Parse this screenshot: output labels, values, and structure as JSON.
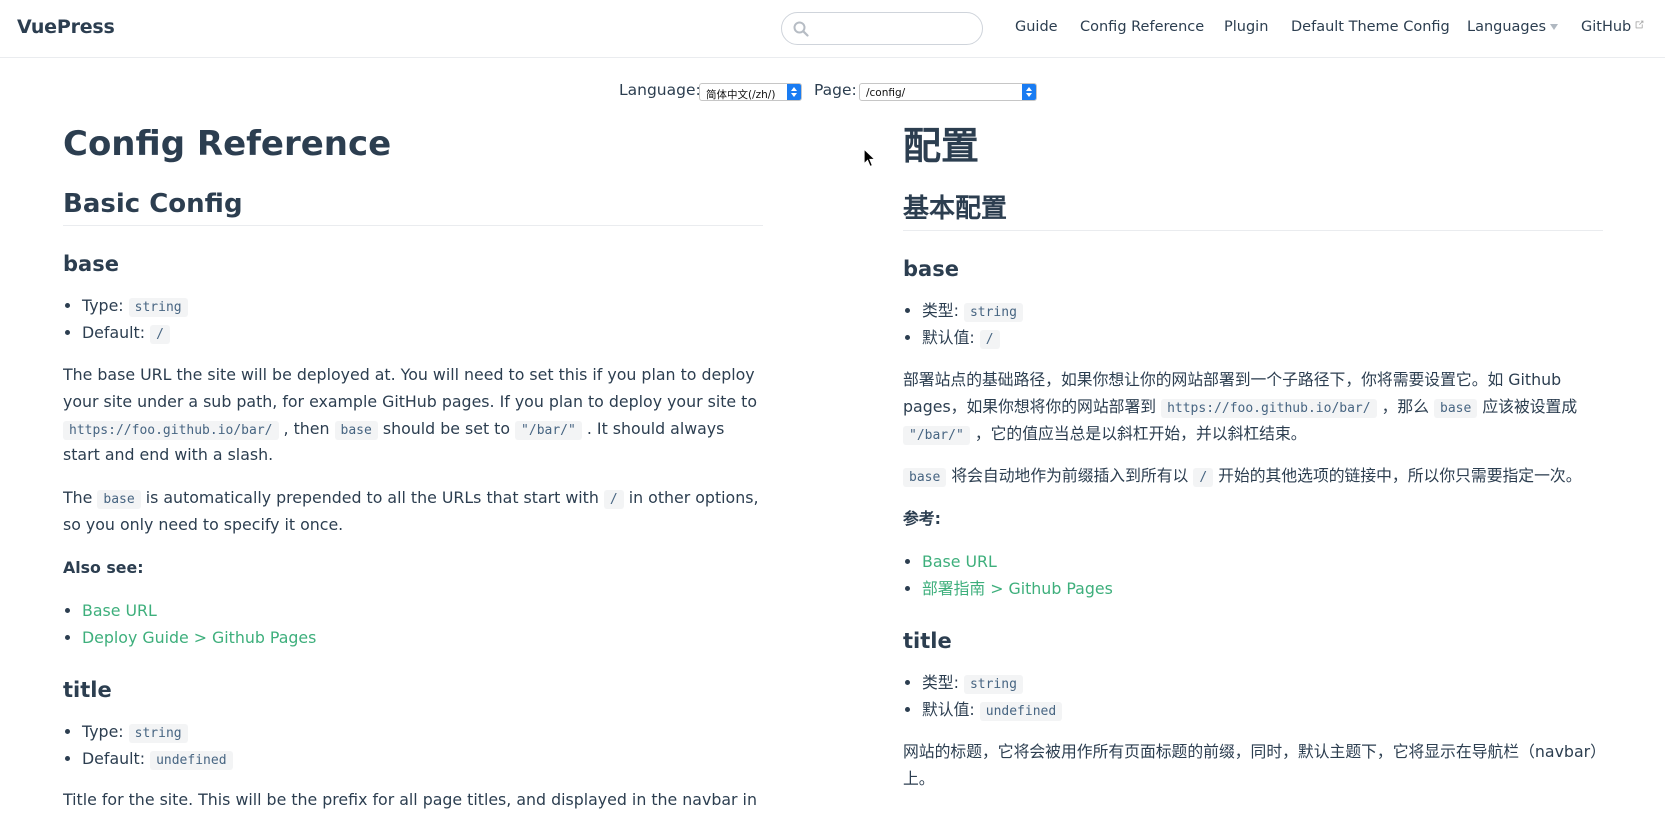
{
  "navbar": {
    "brand": "VuePress",
    "search_placeholder": "",
    "links": [
      {
        "label": "Guide"
      },
      {
        "label": "Config Reference"
      },
      {
        "label": "Plugin"
      },
      {
        "label": "Default Theme Config"
      },
      {
        "label": "Languages"
      },
      {
        "label": "GitHub"
      }
    ]
  },
  "selector": {
    "language_label": "Language:",
    "language_value": "简体中文(/zh/)",
    "page_label": "Page:",
    "page_value": "/config/"
  },
  "left": {
    "title": "Config Reference",
    "section": "Basic Config",
    "base": {
      "heading": "base",
      "type_label": "Type:",
      "type_value": "string",
      "default_label": "Default:",
      "default_value": "/",
      "p1_a": "The base URL the site will be deployed at. You will need to set this if you plan to deploy your site under a sub path, for example GitHub pages. If you plan to deploy your site to ",
      "p1_code1": "https://foo.github.io/bar/",
      "p1_b": " , then ",
      "p1_code2": "base",
      "p1_c": " should be set to ",
      "p1_code3": "\"/bar/\"",
      "p1_d": " . It should always start and end with a slash.",
      "p2_a": "The ",
      "p2_code1": "base",
      "p2_b": " is automatically prepended to all the URLs that start with ",
      "p2_code2": "/",
      "p2_c": " in other options, so you only need to specify it once.",
      "also_see": "Also see:",
      "links": [
        "Base URL",
        "Deploy Guide > Github Pages"
      ]
    },
    "title_opt": {
      "heading": "title",
      "type_label": "Type:",
      "type_value": "string",
      "default_label": "Default:",
      "default_value": "undefined",
      "p1": "Title for the site. This will be the prefix for all page titles, and displayed in the navbar in the default theme."
    }
  },
  "right": {
    "title": "配置",
    "section": "基本配置",
    "base": {
      "heading": "base",
      "type_label": "类型:",
      "type_value": "string",
      "default_label": "默认值:",
      "default_value": "/",
      "p1_a": "部署站点的基础路径，如果你想让你的网站部署到一个子路径下，你将需要设置它。如 Github pages，如果你想将你的网站部署到 ",
      "p1_code1": "https://foo.github.io/bar/",
      "p1_b": " ，那么 ",
      "p1_code2": "base",
      "p1_c": " 应该被设置成 ",
      "p1_code3": "\"/bar/\"",
      "p1_d": " ，它的值应当总是以斜杠开始，并以斜杠结束。",
      "p2_code1": "base",
      "p2_a": " 将会自动地作为前缀插入到所有以 ",
      "p2_code2": "/",
      "p2_b": " 开始的其他选项的链接中，所以你只需要指定一次。",
      "also_see": "参考:",
      "links": [
        "Base URL",
        "部署指南 > Github Pages"
      ]
    },
    "title_opt": {
      "heading": "title",
      "type_label": "类型:",
      "type_value": "string",
      "default_label": "默认值:",
      "default_value": "undefined",
      "p1": "网站的标题，它将会被用作所有页面标题的前缀，同时，默认主题下，它将显示在导航栏（navbar）上。"
    }
  },
  "colors": {
    "text": "#2c3e50",
    "link": "#3eaf7c",
    "code": "#476582",
    "select_accent": "#1a7cf2"
  }
}
